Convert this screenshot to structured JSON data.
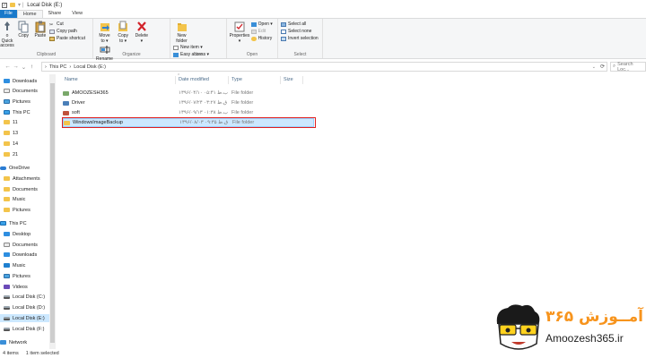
{
  "window": {
    "title": "Local Disk (E:)"
  },
  "tabs": [
    {
      "label": "File"
    },
    {
      "label": "Home"
    },
    {
      "label": "Share"
    },
    {
      "label": "View"
    }
  ],
  "ribbon": {
    "clipboard": {
      "pin_label": "o Quick\naccess",
      "copy_label": "Copy",
      "paste_label": "Paste",
      "cut_label": "Cut",
      "copy_path_label": "Copy path",
      "paste_shortcut_label": "Paste shortcut",
      "group_label": "Clipboard"
    },
    "organize": {
      "move_label": "Move\nto ▾",
      "copy_to_label": "Copy\nto ▾",
      "delete_label": "Delete\n▾",
      "rename_label": "Rename",
      "group_label": "Organize"
    },
    "new": {
      "new_folder_label": "New\nfolder",
      "new_item_label": "New item ▾",
      "easy_access_label": "Easy access ▾",
      "group_label": "New"
    },
    "open": {
      "properties_label": "Properties\n▾",
      "open_label": "Open ▾",
      "edit_label": "Edit",
      "history_label": "History",
      "group_label": "Open"
    },
    "select": {
      "select_all_label": "Select all",
      "select_none_label": "Select none",
      "invert_label": "Invert selection",
      "group_label": "Select"
    }
  },
  "address": {
    "crumb1": "This PC",
    "crumb2": "Local Disk (E:)",
    "search_placeholder": "Search Loc..."
  },
  "sidebar": {
    "items": [
      {
        "label": "Downloads"
      },
      {
        "label": "Documents"
      },
      {
        "label": "Pictures"
      },
      {
        "label": "This PC"
      },
      {
        "label": "11"
      },
      {
        "label": "13"
      },
      {
        "label": "14"
      },
      {
        "label": "21"
      },
      {
        "label": "OneDrive"
      },
      {
        "label": "Attachments"
      },
      {
        "label": "Documents"
      },
      {
        "label": "Music"
      },
      {
        "label": "Pictures"
      },
      {
        "label": "This PC"
      },
      {
        "label": "Desktop"
      },
      {
        "label": "Documents"
      },
      {
        "label": "Downloads"
      },
      {
        "label": "Music"
      },
      {
        "label": "Pictures"
      },
      {
        "label": "Videos"
      },
      {
        "label": "Local Disk (C:)"
      },
      {
        "label": "Local Disk (D:)"
      },
      {
        "label": "Local Disk (E:)"
      },
      {
        "label": "Local Disk (F:)"
      },
      {
        "label": "Network"
      }
    ]
  },
  "columns": {
    "name": "Name",
    "date": "Date modified",
    "type": "Type",
    "size": "Size"
  },
  "files": [
    {
      "name": "AMOOZESH365",
      "date": "۱۳۹۶/۰۴/۱۰ ب.ظ ۰۵:۴۱",
      "type": "File folder"
    },
    {
      "name": "Driver",
      "date": "۱۳۹۶/۰۷/۲۴ ق.ظ ۰۳:۲۷",
      "type": "File folder"
    },
    {
      "name": "soft",
      "date": "۱۳۹۶/۰۹/۱۳ ب.ظ ۰۱:۳۸",
      "type": "File folder"
    },
    {
      "name": "WindowsImageBackup",
      "date": "۱۳۹۶/۰۸/۰۳ ق.ظ ۰۹:۳۵",
      "type": "File folder"
    }
  ],
  "status": {
    "count": "4 items",
    "selected": "1 item selected"
  },
  "watermark": {
    "persian": "آمــوزش ۳۶۵",
    "site": "Amoozesh365.ir"
  },
  "colors": {
    "file_tab": "#1979ca",
    "selection": "#cce8ff",
    "highlight_border": "#e02020",
    "folder": "#f3c44b",
    "logo_orange": "#f7941d"
  }
}
